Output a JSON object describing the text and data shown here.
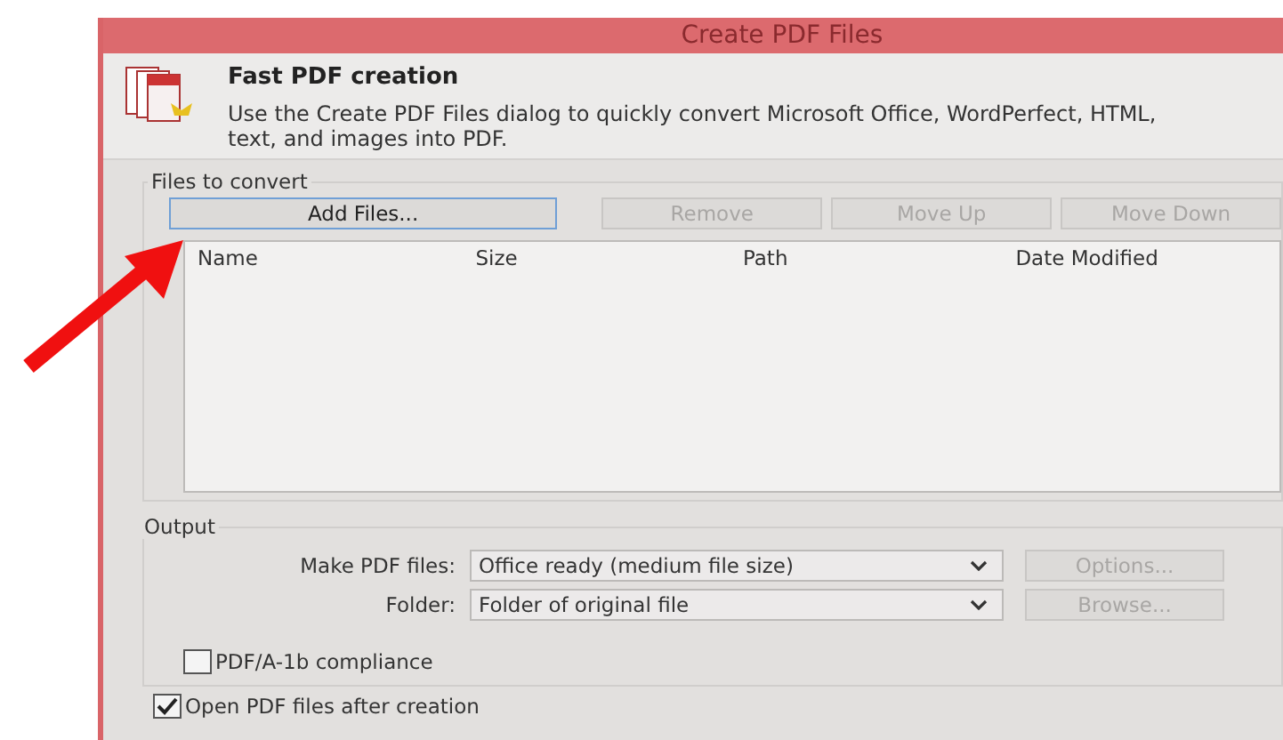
{
  "window": {
    "title": "Create PDF Files"
  },
  "header": {
    "title": "Fast PDF creation",
    "description": "Use the Create PDF Files dialog to quickly convert Microsoft Office, WordPerfect, HTML, text, and images into PDF."
  },
  "files_group": {
    "label": "Files to convert",
    "buttons": [
      {
        "label": "Add Files...",
        "disabled": false
      },
      {
        "label": "Remove",
        "disabled": true
      },
      {
        "label": "Move Up",
        "disabled": true
      },
      {
        "label": "Move Down",
        "disabled": true
      }
    ],
    "columns": [
      "Name",
      "Size",
      "Path",
      "Date Modified"
    ]
  },
  "output_group": {
    "label": "Output",
    "rows": [
      {
        "label": "Make PDF files:",
        "value": "Office ready (medium file size)",
        "button": {
          "label": "Options...",
          "disabled": true
        }
      },
      {
        "label": "Folder:",
        "value": "Folder of original file",
        "button": {
          "label": "Browse...",
          "disabled": true
        }
      }
    ],
    "pdfa": {
      "label": "PDF/A-1b compliance",
      "checked": false
    }
  },
  "open_after": {
    "label": "Open PDF files after creation",
    "checked": true
  }
}
